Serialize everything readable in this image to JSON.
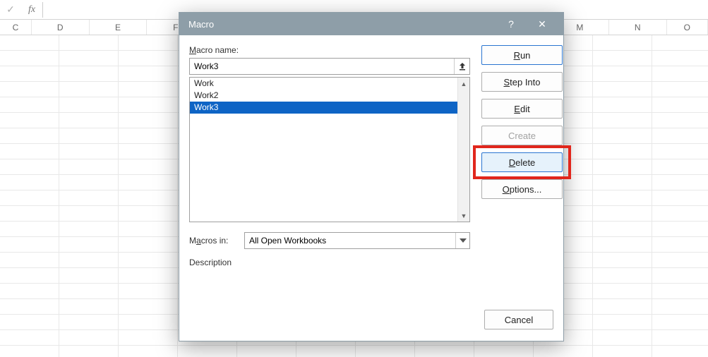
{
  "formula_bar": {
    "fx": "fx",
    "check": "✓",
    "value": ""
  },
  "columns": [
    "C",
    "D",
    "E",
    "F",
    "",
    "",
    "",
    "",
    "",
    "",
    "M",
    "N",
    "O"
  ],
  "dialog": {
    "title": "Macro",
    "help": "?",
    "close": "✕",
    "macro_name_label": "Macro name:",
    "macro_name_value": "Work3",
    "list": [
      {
        "label": "Work",
        "selected": false
      },
      {
        "label": "Work2",
        "selected": false
      },
      {
        "label": "Work3",
        "selected": true
      }
    ],
    "macros_in_label": "Macros in:",
    "macros_in_value": "All Open Workbooks",
    "description_label": "Description",
    "buttons": {
      "run": "Run",
      "step_into": "Step Into",
      "edit": "Edit",
      "create": "Create",
      "delete": "Delete",
      "options": "Options...",
      "cancel": "Cancel"
    }
  },
  "highlight": {
    "button": "delete"
  }
}
